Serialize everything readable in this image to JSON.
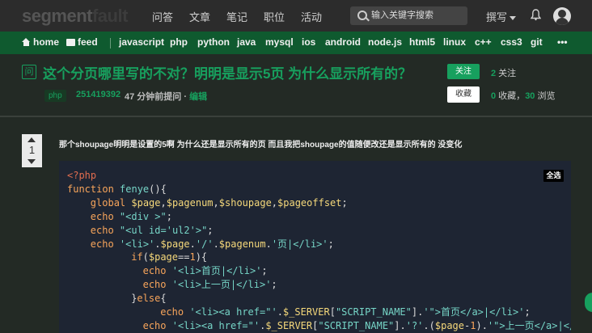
{
  "topbar": {
    "logo_a": "segment",
    "logo_b": "fault",
    "nav": [
      "问答",
      "文章",
      "笔记",
      "职位",
      "活动"
    ],
    "search_placeholder": "输入关键字搜索",
    "write_label": "撰写"
  },
  "green_nav": {
    "home": "home",
    "feed": "feed",
    "tags": [
      "javascript",
      "php",
      "python",
      "java",
      "mysql",
      "ios",
      "android",
      "node.js",
      "html5",
      "linux",
      "c++",
      "css3",
      "git"
    ],
    "more": "•••"
  },
  "question": {
    "icon_text": "问",
    "title": "这个分页哪里写的不对？明明是显示5页 为什么显示所有的？",
    "tag": "php",
    "author": "251419392",
    "time": "47 分钟前提问 · ",
    "edit_label": "编辑",
    "follow_label": "关注",
    "collect_label": "收藏",
    "followers_count": "2",
    "followers_label": " 关注",
    "collect_count": "0",
    "collect_text": " 收藏，",
    "views_count": "30",
    "views_label": " 浏览",
    "votes": "1",
    "body": "那个shoupage明明是设置的5啊 为什么还是显示所有的页 而且我把shoupage的值随便改还是显示所有的 没变化"
  },
  "code": {
    "select_all": "全选",
    "lines": [
      {
        "i": 0,
        "parts": [
          [
            "tg",
            "<?php"
          ]
        ]
      },
      {
        "i": 0,
        "parts": [
          [
            "k",
            "function "
          ],
          [
            "s",
            "fenye"
          ],
          [
            "p",
            "(){"
          ]
        ]
      },
      {
        "i": 4,
        "parts": [
          [
            "k",
            "global "
          ],
          [
            "v",
            "$page"
          ],
          [
            "p",
            ","
          ],
          [
            "v",
            "$pagenum"
          ],
          [
            "p",
            ","
          ],
          [
            "v",
            "$shoupage"
          ],
          [
            "p",
            ","
          ],
          [
            "v",
            "$pageoffset"
          ],
          [
            "p",
            ";"
          ]
        ]
      },
      {
        "i": 4,
        "parts": [
          [
            "k",
            "echo "
          ],
          [
            "s",
            "\"<div >\""
          ],
          [
            "p",
            ";"
          ]
        ]
      },
      {
        "i": 4,
        "parts": [
          [
            "k",
            "echo "
          ],
          [
            "s",
            "\"<ul id='ul2'>\""
          ],
          [
            "p",
            ";"
          ]
        ]
      },
      {
        "i": 4,
        "parts": [
          [
            "k",
            "echo "
          ],
          [
            "s",
            "'<li>'"
          ],
          [
            "p",
            "."
          ],
          [
            "v",
            "$page"
          ],
          [
            "p",
            "."
          ],
          [
            "s",
            "'/'"
          ],
          [
            "p",
            "."
          ],
          [
            "v",
            "$pagenum"
          ],
          [
            "p",
            "."
          ],
          [
            "s",
            "'页|</li>'"
          ],
          [
            "p",
            ";"
          ]
        ]
      },
      {
        "i": 11,
        "parts": [
          [
            "k",
            "if"
          ],
          [
            "p",
            "("
          ],
          [
            "v",
            "$page"
          ],
          [
            "p",
            "=="
          ],
          [
            "n",
            "1"
          ],
          [
            "p",
            "){"
          ]
        ]
      },
      {
        "i": 13,
        "parts": [
          [
            "k",
            "echo "
          ],
          [
            "s",
            "'<li>首页|</li>'"
          ],
          [
            "p",
            ";"
          ]
        ]
      },
      {
        "i": 13,
        "parts": [
          [
            "k",
            "echo "
          ],
          [
            "s",
            "'<li>上一页|</li>'"
          ],
          [
            "p",
            ";"
          ]
        ]
      },
      {
        "i": 11,
        "parts": [
          [
            "p",
            "}"
          ],
          [
            "k",
            "else"
          ],
          [
            "p",
            "{"
          ]
        ]
      },
      {
        "i": 16,
        "parts": [
          [
            "k",
            "echo "
          ],
          [
            "s",
            "'<li><a href=\"'"
          ],
          [
            "p",
            "."
          ],
          [
            "v",
            "$_SERVER"
          ],
          [
            "p",
            "["
          ],
          [
            "s",
            "\"SCRIPT_NAME\""
          ],
          [
            "p",
            "]."
          ],
          [
            "s",
            "'\">首页</a>|</li>'"
          ],
          [
            "p",
            ";"
          ]
        ]
      },
      {
        "i": 13,
        "parts": [
          [
            "k",
            "echo "
          ],
          [
            "s",
            "'<li><a href=\"'"
          ],
          [
            "p",
            "."
          ],
          [
            "v",
            "$_SERVER"
          ],
          [
            "p",
            "["
          ],
          [
            "s",
            "\"SCRIPT_NAME\""
          ],
          [
            "p",
            "]."
          ],
          [
            "s",
            "'?'"
          ],
          [
            "p",
            ".("
          ],
          [
            "v",
            "$page"
          ],
          [
            "p",
            "-"
          ],
          [
            "n",
            "1"
          ],
          [
            "p",
            ")."
          ],
          [
            "s",
            "'\">上一页</a>|</"
          ]
        ]
      },
      {
        "i": 11,
        "parts": [
          [
            "p",
            "}"
          ]
        ]
      }
    ]
  }
}
